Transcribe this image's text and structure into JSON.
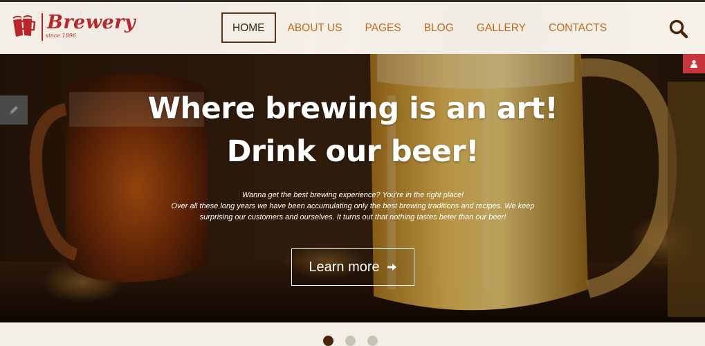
{
  "logo": {
    "word": "Brewery",
    "since": "since 1896"
  },
  "nav": {
    "items": [
      {
        "label": "HOME",
        "active": true
      },
      {
        "label": "ABOUT US",
        "active": false
      },
      {
        "label": "PAGES",
        "active": false
      },
      {
        "label": "BLOG",
        "active": false
      },
      {
        "label": "GALLERY",
        "active": false
      },
      {
        "label": "CONTACTS",
        "active": false
      }
    ]
  },
  "icons": {
    "search": "search-icon",
    "edit": "pencil-icon",
    "user": "user-icon",
    "logo": "beer-mugs-icon",
    "cta": "arrow-right-icon"
  },
  "hero": {
    "title": "Where brewing is an art! Drink our beer!",
    "subtitle_line1": "Wanna get the best brewing experience? You're in the right place!",
    "subtitle_line2": "Over all these long years we have been accumulating only the best brewing traditions and recipes. We keep surprising our customers and ourselves. It turns out that nothing tastes beter than our beer!",
    "cta_label": "Learn more"
  },
  "slider": {
    "dots": 3,
    "active_index": 0
  },
  "colors": {
    "brand_red": "#b8262a",
    "nav_text": "#c4691b",
    "nav_active": "#3a2210",
    "dot_active": "#4a2608",
    "dot_inactive": "#c9c3b6",
    "user_tab": "#c8353a"
  }
}
